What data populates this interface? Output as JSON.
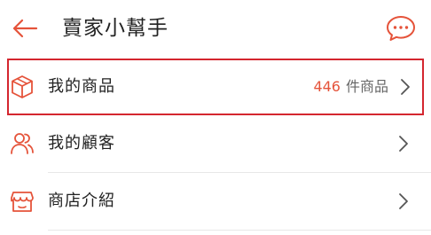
{
  "header": {
    "title": "賣家小幫手",
    "back_icon": "arrow-left-icon",
    "chat_icon": "chat-bubble-icon"
  },
  "menu": {
    "items": [
      {
        "label": "我的商品",
        "icon": "box-icon",
        "count": "446",
        "count_suffix": "件商品",
        "selected": true
      },
      {
        "label": "我的顧客",
        "icon": "users-icon",
        "selected": false
      },
      {
        "label": "商店介紹",
        "icon": "store-icon",
        "selected": false
      }
    ]
  },
  "colors": {
    "accent": "#e5533a",
    "highlight_border": "#d4262f",
    "text": "#222222"
  }
}
